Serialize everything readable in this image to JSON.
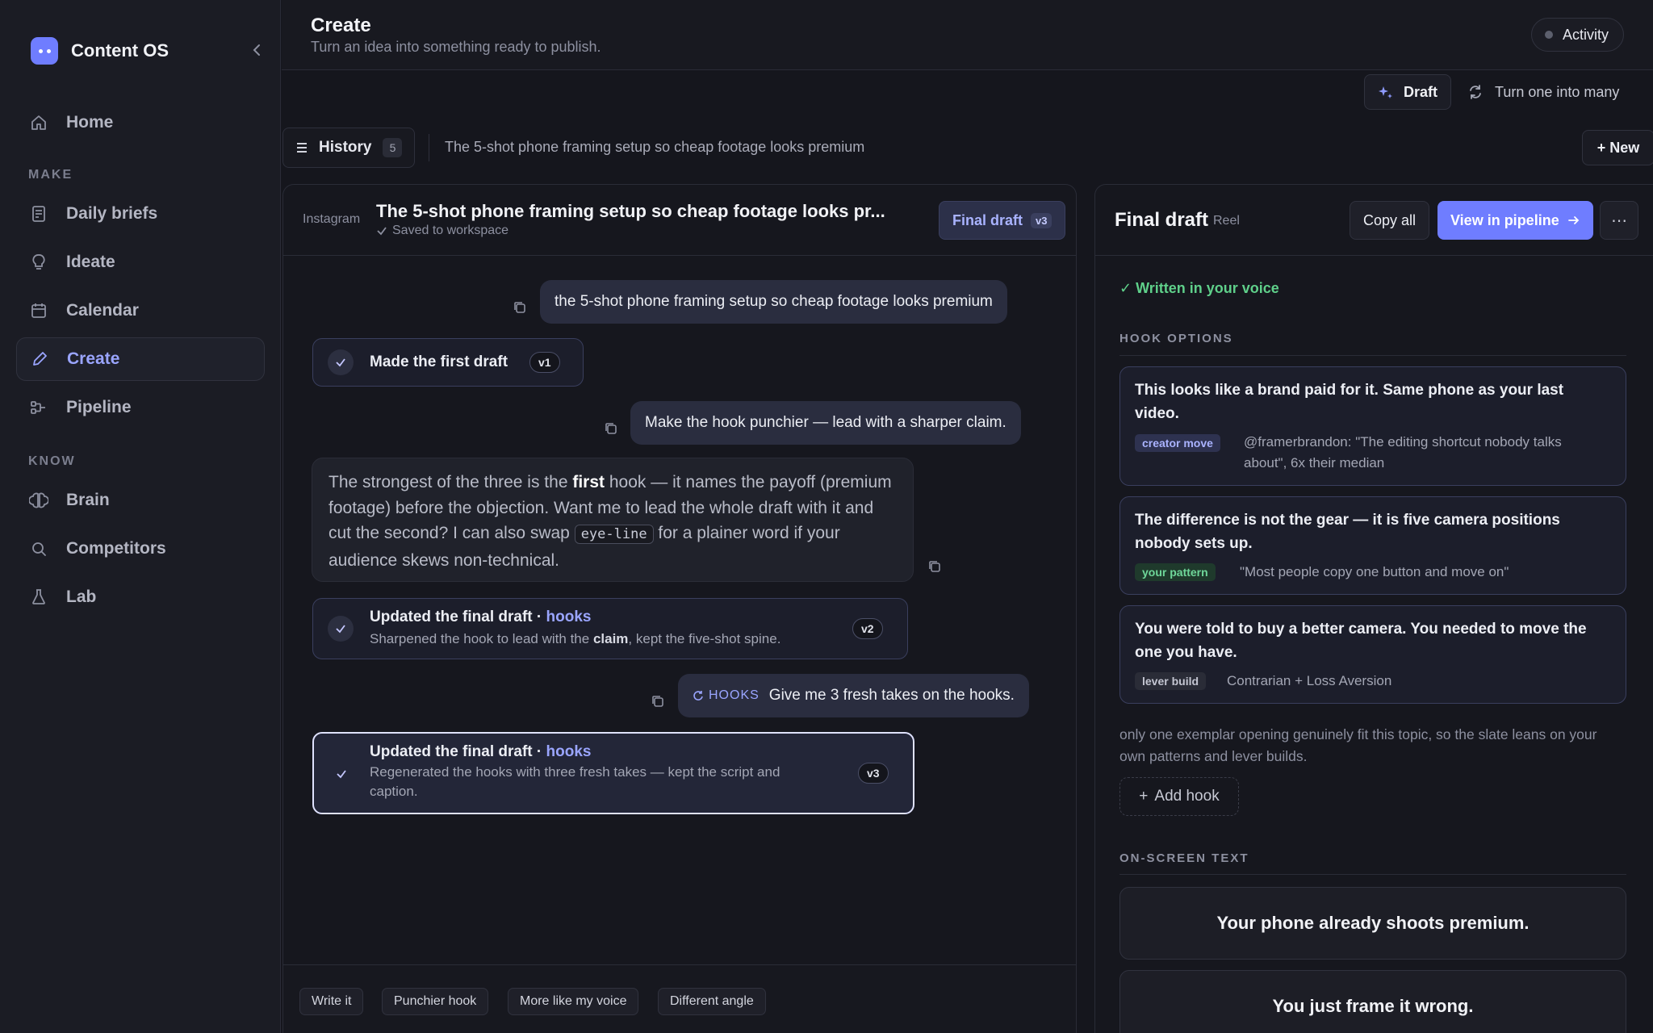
{
  "app": {
    "name": "Content OS"
  },
  "sidebar": {
    "home": "Home",
    "sections": {
      "make": "MAKE",
      "know": "KNOW"
    },
    "make_items": [
      "Daily briefs",
      "Ideate",
      "Calendar",
      "Create",
      "Pipeline"
    ],
    "know_items": [
      "Brain",
      "Competitors",
      "Lab"
    ],
    "active": "Create"
  },
  "header": {
    "title": "Create",
    "subtitle": "Turn an idea into something ready to publish.",
    "activity": "Activity"
  },
  "modes": {
    "draft": "Draft",
    "repurpose": "Turn one into many"
  },
  "history": {
    "label": "History",
    "count": "5",
    "topic": "The 5-shot phone framing setup so cheap footage looks premium",
    "new": "+ New"
  },
  "chat": {
    "platform": "Instagram",
    "title": "The 5-shot phone framing setup so cheap footage looks pr...",
    "saved": "Saved to workspace",
    "final_chip": "Final draft",
    "final_ver": "v3",
    "messages": {
      "u1": "the 5-shot phone framing setup so cheap footage looks premium",
      "ev1_title": "Made the first draft",
      "ev1_ver": "v1",
      "u2": "Make the hook punchier — lead with a sharper claim.",
      "a1_p1": "The strongest of the three is the ",
      "a1_bold": "first",
      "a1_p2": " hook — it names the payoff (premium footage) before the objection. Want me to lead the whole draft with it and cut the second? I can also swap ",
      "a1_code": "eye-line",
      "a1_p3": " for a plainer word if your audience skews non-technical.",
      "ev2_title": "Updated the final draft · ",
      "ev2_em": "hooks",
      "ev2_sub_a": "Sharpened the hook to lead with the ",
      "ev2_sub_b": "claim",
      "ev2_sub_c": ", kept the five-shot spine.",
      "ev2_ver": "v2",
      "u3_tag": "HOOKS",
      "u3": "Give me 3 fresh takes on the hooks.",
      "ev3_title": "Updated the final draft · ",
      "ev3_em": "hooks",
      "ev3_sub": "Regenerated the hooks with three fresh takes — kept the script and caption.",
      "ev3_ver": "v3"
    },
    "chips": [
      "Write it",
      "Punchier hook",
      "More like my voice",
      "Different angle"
    ]
  },
  "draft": {
    "title": "Final draft",
    "type": "Reel",
    "copy_all": "Copy all",
    "view_pipeline": "View in pipeline",
    "more": "⋯",
    "voice": "✓ Written in your voice",
    "hook_label": "HOOK OPTIONS",
    "hooks": [
      {
        "text": "This looks like a brand paid for it. Same phone as your last video.",
        "tag": "creator move",
        "note": "@framerbrandon: \"The editing shortcut nobody talks about\", 6x their median"
      },
      {
        "text": "The difference is not the gear — it is five camera positions nobody sets up.",
        "tag": "your pattern",
        "note": "\"Most people copy one button and move on\""
      },
      {
        "text": "You were told to buy a better camera. You needed to move the one you have.",
        "tag": "lever build",
        "note": "Contrarian + Loss Aversion"
      }
    ],
    "hook_note": "only one exemplar opening genuinely fit this topic, so the slate leans on your own patterns and lever builds.",
    "add_hook": "Add hook",
    "ost_label": "ON-SCREEN TEXT",
    "ost": [
      "Your phone already shoots premium.",
      "You just frame it wrong."
    ]
  },
  "colors": {
    "accent": "#6f7dff",
    "success": "#5fd08a",
    "background": "#15161d"
  }
}
